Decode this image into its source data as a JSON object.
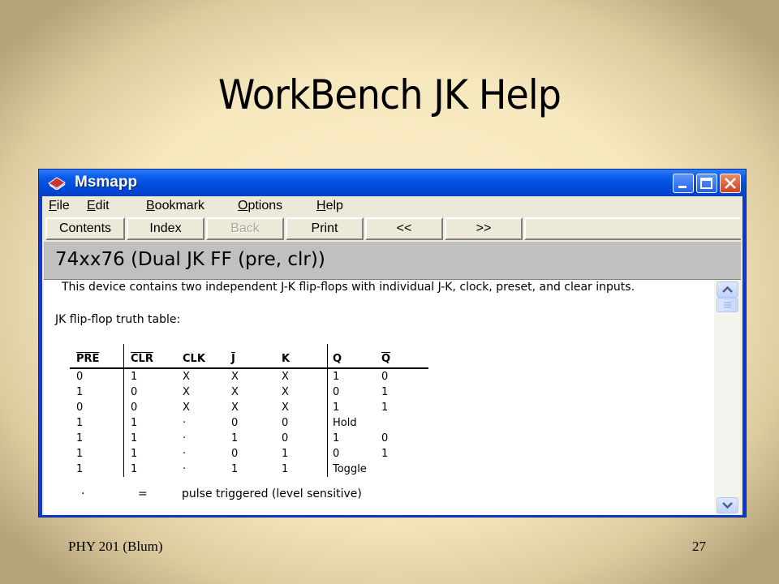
{
  "slide": {
    "title": "WorkBench JK Help",
    "footer_left": "PHY 201 (Blum)",
    "footer_right": "27"
  },
  "window": {
    "title": "Msmapp",
    "icons": {
      "app": "book-icon",
      "minimize": "minimize-icon",
      "maximize": "maximize-icon",
      "close": "close-icon"
    }
  },
  "menu": [
    {
      "label": "File",
      "u": "F",
      "rest": "ile"
    },
    {
      "label": "Edit",
      "u": "E",
      "rest": "dit"
    },
    {
      "label": "Bookmark",
      "u": "B",
      "rest": "ookmark"
    },
    {
      "label": "Options",
      "u": "O",
      "rest": "ptions"
    },
    {
      "label": "Help",
      "u": "H",
      "rest": "elp"
    }
  ],
  "toolbar": {
    "contents": "Contents",
    "index": "Index",
    "back": "Back",
    "print": "Print",
    "prev": "<<",
    "next": ">>"
  },
  "topic": {
    "title": "74xx76 (Dual JK FF (pre, clr))",
    "description": "This device contains two independent J-K flip-flops with individual J-K, clock, preset, and clear inputs.",
    "table_label": "JK flip-flop truth table:",
    "table": {
      "headers": [
        "PRE",
        "CLR",
        "CLK",
        "J",
        "K",
        "Q",
        "Q"
      ],
      "rows": [
        [
          "0",
          "1",
          "X",
          "X",
          "X",
          "1",
          "0"
        ],
        [
          "1",
          "0",
          "X",
          "X",
          "X",
          "0",
          "1"
        ],
        [
          "0",
          "0",
          "X",
          "X",
          "X",
          "1",
          "1"
        ],
        [
          "1",
          "1",
          "·",
          "0",
          "0",
          "Hold",
          ""
        ],
        [
          "1",
          "1",
          "·",
          "1",
          "0",
          "1",
          "0"
        ],
        [
          "1",
          "1",
          "·",
          "0",
          "1",
          "0",
          "1"
        ],
        [
          "1",
          "1",
          "·",
          "1",
          "1",
          "Toggle",
          ""
        ]
      ]
    },
    "note": {
      "symbol": "·",
      "equals": "=",
      "text": "pulse triggered (level sensitive)"
    }
  }
}
